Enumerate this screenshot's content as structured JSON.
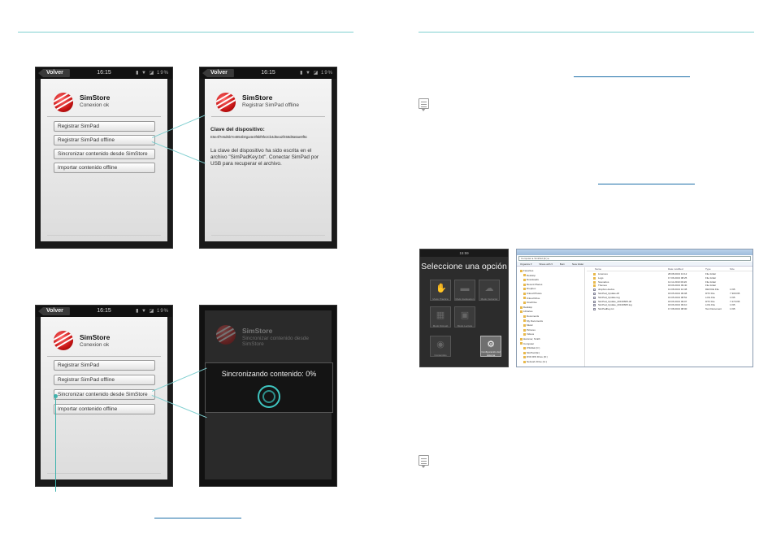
{
  "phone_common": {
    "back_label": "Volver",
    "time": "16:15",
    "status_icons": "▮ ▼ ◪ 19%",
    "brand": "SimStore"
  },
  "screen1": {
    "subtitle": "Conexion ok",
    "buttons": [
      "Registrar SimPad",
      "Registrar SimPad offline",
      "Sincronizar contenido desde SimStore",
      "Importar contenido offline"
    ]
  },
  "screen2": {
    "subtitle": "Registrar SimPad offline",
    "key_title": "Clave del dispositivo:",
    "key_value": "E5e4f7e5d5b7e4854b0ga4e3f6bf9fe2cb4d6ea2f458d8a6ae8f5c",
    "info": "La clave del dispositivo ha sido escrita en el archivo \"SimPadKey.txt\". Conectar SimPad por USB para recuperar el archivo."
  },
  "screen3": {
    "subtitle": "Conexion ok",
    "buttons": [
      "Registrar SimPad",
      "Registrar SimPad offline",
      "Sincronizar contenido desde SimStore",
      "Importar contenido offline"
    ]
  },
  "screen4": {
    "subtitle": "Sincronizar contenido desde SimStore",
    "sync_text": "Sincronizando contenido: 0%"
  },
  "option_screen": {
    "time": "15:59",
    "title": "Seleccione una opción",
    "tiles": [
      {
        "label": "Modo Practica",
        "glyph": "✋"
      },
      {
        "label": "Modo Evaluacion",
        "glyph": "▬"
      },
      {
        "label": "Modo Instructor",
        "glyph": "☁"
      },
      {
        "label": "Modo SimLab",
        "glyph": "▦"
      },
      {
        "label": "Modo Lectura",
        "glyph": "▣"
      },
      {
        "label": "Contenidos",
        "glyph": "◉"
      },
      {
        "label": "Configuración del sistema",
        "glyph": "⚙"
      }
    ]
  },
  "explorer": {
    "address": "Computer ▸ SimPad (E:) ▸",
    "toolbar": [
      "Organize ▾",
      "Share with ▾",
      "Burn",
      "New folder"
    ],
    "nav": [
      "Favorites",
      "Desktop",
      "Downloads",
      "Recent Places",
      "Dropbox",
      "iCloud Photos",
      "iCloud Drive",
      "OneDrive",
      "Desktop",
      "Libraries",
      "Documents",
      "My Documents",
      "Music",
      "Pictures",
      "Videos",
      "Hammer, Smith",
      "Computer",
      "OS/disk (C:)",
      "SimPad (E:)",
      "DVD RW Drive (D:)",
      "Network Drive (G:)"
    ],
    "columns": [
      "Name",
      "Date modified",
      "Type",
      "Size"
    ],
    "files": [
      {
        "name": "Licences",
        "date": "28.08.2013 13:12",
        "type": "File folder",
        "size": ""
      },
      {
        "name": "Logs",
        "date": "17.06.2013 08:25",
        "type": "File folder",
        "size": ""
      },
      {
        "name": "Scenarios",
        "date": "14.11.2013 09:20",
        "type": "File folder",
        "size": ""
      },
      {
        "name": "Themes",
        "date": "18.06.2013 09:40",
        "type": "File folder",
        "size": ""
      },
      {
        "name": "dropbox.device",
        "date": "13.08.2013 10:38",
        "type": "DEVICE File",
        "size": "1 KB"
      },
      {
        "name": "SimPad_Update.dtf",
        "date": "18.05.2013 09:08",
        "type": "DTF File",
        "size": "7 309 KB"
      },
      {
        "name": "SimPad_Update.log",
        "date": "16.05.2013 08:52",
        "type": "LOG File",
        "size": "1 KB"
      },
      {
        "name": "SimPad_Update_20130605.dtf",
        "date": "18.06.2013 09:07",
        "type": "DTF File",
        "size": "7 270 KB"
      },
      {
        "name": "SimPad_Update_20130605.log",
        "date": "18.06.2013 09:10",
        "type": "LOG File",
        "size": "1 KB"
      },
      {
        "name": "SimPadKey.txt",
        "date": "17.08.2013 08:00",
        "type": "Text Document",
        "size": "1 KB"
      }
    ]
  }
}
